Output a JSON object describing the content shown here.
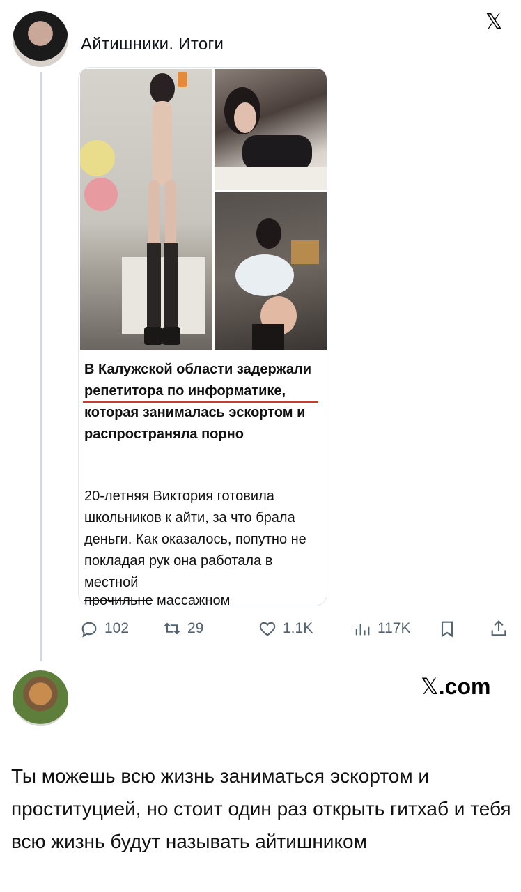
{
  "brand": {
    "logo_top": "𝕏",
    "footer_x": "𝕏",
    "footer_domain": ".com"
  },
  "tweet": {
    "author": "Айтишники. Итоги",
    "article": {
      "headline": "В Калужской области задержали репетитора по информатике, которая занималась эскортом и распространяла порно",
      "body": "20-летняя Виктория готовила школьников к айти, за что брала деньги. Как оказалось, попутно не покладая рук она работала в местной",
      "body_cut_strike": "прочильне",
      "body_cut_rest": " массажном"
    },
    "actions": {
      "reply_count": "102",
      "retweet_count": "29",
      "like_count": "1.1K",
      "views_count": "117K"
    }
  },
  "reply": {
    "text": "Ты можешь всю жизнь заниматься эскортом и проституцией, но стоит один раз открыть гитхаб и тебя всю жизнь будут называть айтишником"
  },
  "colors": {
    "icon_gray": "#536471",
    "thread_line": "#cfd9de",
    "underline_red": "#cf3a2f"
  },
  "icons": [
    "x-logo-icon",
    "reply-icon",
    "retweet-icon",
    "like-icon",
    "views-icon",
    "bookmark-icon",
    "share-icon"
  ]
}
